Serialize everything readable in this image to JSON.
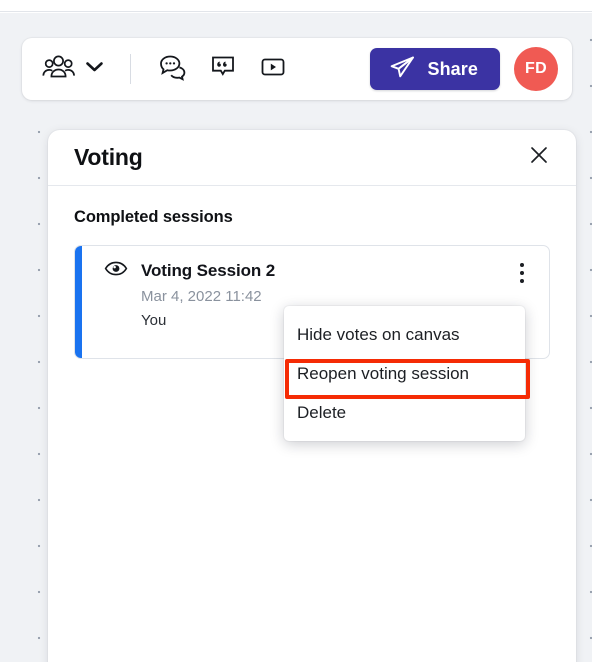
{
  "toolbar": {
    "people_icon": "people-group-icon",
    "chevron_icon": "chevron-down-icon",
    "comment_icon": "comment-bubble-icon",
    "quote_icon": "quote-bubble-icon",
    "present_icon": "play-frame-icon",
    "share_icon": "paper-plane-icon",
    "share_label": "Share",
    "avatar_initials": "FD",
    "avatar_color": "#f05a53",
    "share_color": "#3b33a3"
  },
  "panel": {
    "title": "Voting",
    "close_icon": "close-icon",
    "section_title": "Completed sessions",
    "session": {
      "visibility_icon": "eye-icon",
      "name": "Voting Session 2",
      "date": "Mar 4, 2022 11:42",
      "author": "You",
      "accent_color": "#1a73f0",
      "menu_icon": "kebab-menu-icon"
    }
  },
  "context_menu": {
    "items": [
      {
        "label": "Hide votes on canvas",
        "highlighted": false
      },
      {
        "label": "Reopen voting session",
        "highlighted": true
      },
      {
        "label": "Delete",
        "highlighted": false
      }
    ],
    "highlight_color": "#f52b05"
  }
}
